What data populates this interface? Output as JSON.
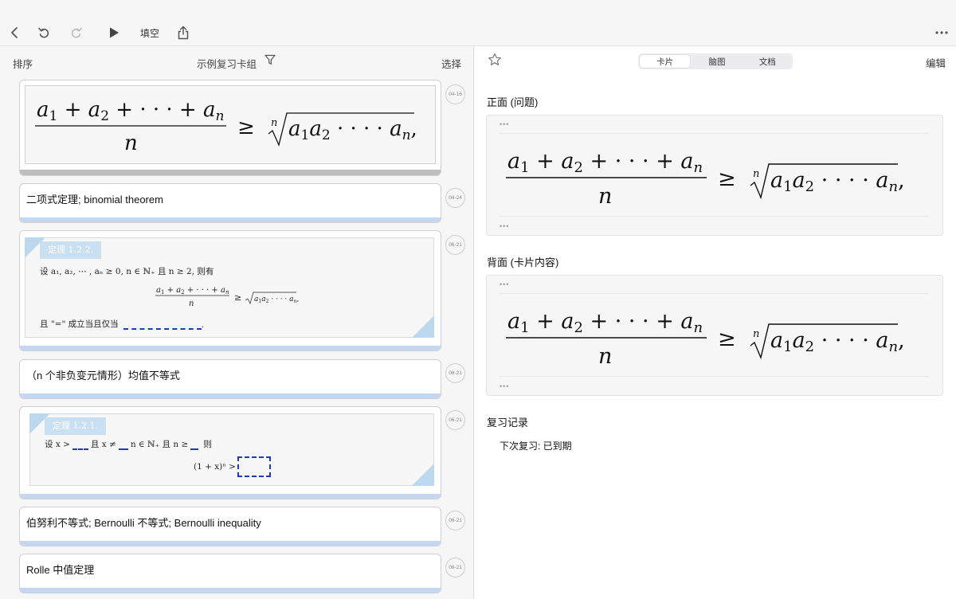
{
  "toolbar": {
    "fill_label": "填空",
    "icons": [
      "chevron-left-icon",
      "undo-icon",
      "redo-icon",
      "play-icon",
      "share-icon",
      "more-icon"
    ]
  },
  "left": {
    "sort_label": "排序",
    "deck_title": "示例复习卡组",
    "select_label": "选择",
    "cards": [
      {
        "type": "formula",
        "date": "04-16"
      },
      {
        "type": "text",
        "text": "二项式定理; binomial theorem",
        "date": "04-24"
      },
      {
        "type": "theorem",
        "date": "06-21",
        "header": "定理 1.2.2.",
        "line1": "设 a₁, a₂, ⋯ , aₙ ≥ 0, n ∈ ℕ₊ 且 n ≥ 2, 则有",
        "line3": "且 \"=\" 成立当且仅当"
      },
      {
        "type": "text",
        "text": "（n 个非负变元情形）均值不等式",
        "date": "06-21"
      },
      {
        "type": "theorem",
        "date": "06-21",
        "header": "定理 1.2.1.",
        "line1": "设 x >",
        "mid1": "且 x ≠",
        "mid2": "n ∈ ℕ₊ 且 n ≥",
        "end1": "则",
        "line2": "(1 + x)ⁿ >"
      },
      {
        "type": "text",
        "text": "伯努利不等式; Bernoulli 不等式; Bernoulli inequality",
        "date": "06-21"
      },
      {
        "type": "text",
        "text": "Rolle 中值定理",
        "date": "06-21"
      }
    ]
  },
  "right": {
    "tabs": [
      {
        "label": "卡片",
        "active": true
      },
      {
        "label": "脑图",
        "active": false
      },
      {
        "label": "文档",
        "active": false
      }
    ],
    "edit_label": "编辑",
    "front_title": "正面 (问题)",
    "back_title": "背面 (卡片内容)",
    "review_title": "复习记录",
    "next_review_label": "下次复习: 已到期",
    "box_dots": "•••"
  },
  "colors": {
    "accent_bar": "#c6d7f3",
    "theorem_header": "#c9dff2",
    "blank_blue": "#1f3bb3"
  }
}
